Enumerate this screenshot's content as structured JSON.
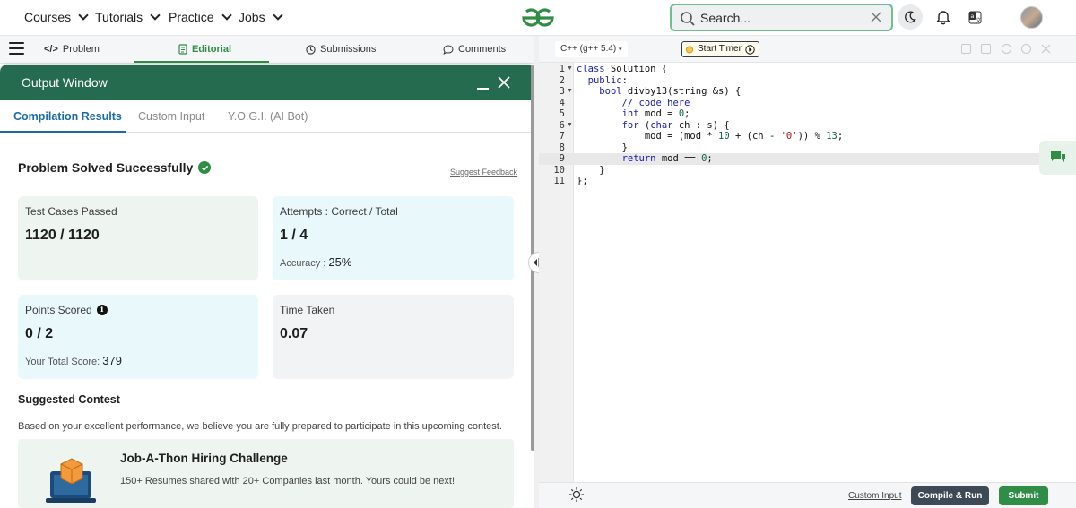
{
  "nav": {
    "items": [
      {
        "label": "Courses"
      },
      {
        "label": "Tutorials"
      },
      {
        "label": "Practice"
      },
      {
        "label": "Jobs"
      }
    ],
    "search_placeholder": "Search..."
  },
  "problem_tabs": [
    {
      "label": "Problem",
      "icon": "code-icon"
    },
    {
      "label": "Editorial",
      "icon": "document-icon",
      "active": true
    },
    {
      "label": "Submissions",
      "icon": "clock-icon"
    },
    {
      "label": "Comments",
      "icon": "comment-icon"
    }
  ],
  "output": {
    "title": "Output Window",
    "tabs": [
      {
        "label": "Compilation Results",
        "active": true
      },
      {
        "label": "Custom Input"
      },
      {
        "label": "Y.O.G.I. (AI Bot)"
      }
    ],
    "status": "Problem Solved Successfully",
    "feedback_link": "Suggest Feedback",
    "cards": {
      "tests": {
        "label": "Test Cases Passed",
        "value": "1120 / 1120"
      },
      "attempts": {
        "label": "Attempts : Correct / Total",
        "value": "1 / 4",
        "sub_label": "Accuracy :",
        "sub_value": "25%"
      },
      "points": {
        "label": "Points Scored",
        "value": "0 / 2",
        "sub_label": "Your Total Score:",
        "sub_value": "379"
      },
      "time": {
        "label": "Time Taken",
        "value": "0.07"
      }
    },
    "suggested": {
      "heading": "Suggested Contest",
      "text": "Based on your excellent performance, we believe you are fully prepared to participate in this upcoming contest.",
      "contest_title": "Job-A-Thon Hiring Challenge",
      "contest_desc": "150+ Resumes shared with 20+ Companies last month. Yours could be next!"
    }
  },
  "editor": {
    "language": "C++ (g++ 5.4)",
    "timer_label": "Start Timer",
    "line_numbers": [
      "1",
      "2",
      "3",
      "4",
      "5",
      "6",
      "7",
      "8",
      "9",
      "10",
      "11"
    ],
    "custom_input_link": "Custom Input",
    "compile_label": "Compile & Run",
    "submit_label": "Submit"
  },
  "colors": {
    "brand_green": "#2f8d46",
    "header_dark_green": "#246b4f",
    "link_blue": "#1c6ba8"
  }
}
